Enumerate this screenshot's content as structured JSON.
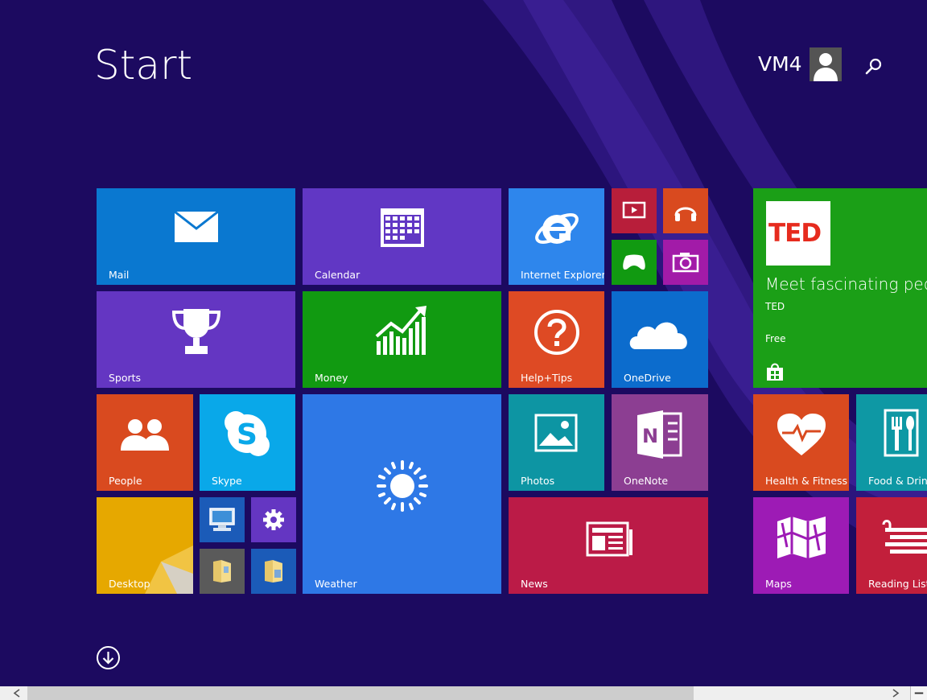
{
  "header": {
    "title": "Start",
    "user_name": "VM4"
  },
  "tiles": {
    "mail": "Mail",
    "calendar": "Calendar",
    "internet_explorer": "Internet Explorer",
    "sports": "Sports",
    "money": "Money",
    "help_tips": "Help+Tips",
    "onedrive": "OneDrive",
    "people": "People",
    "skype": "Skype",
    "weather": "Weather",
    "photos": "Photos",
    "onenote": "OneNote",
    "desktop": "Desktop",
    "news": "News",
    "ted_logo": "TED",
    "ted_headline": "Meet fascinating peo…",
    "ted_name": "TED",
    "ted_price": "Free",
    "health_fitness": "Health & Fitness",
    "food_drink": "Food & Drink",
    "maps": "Maps",
    "reading_list": "Reading List"
  },
  "colors": {
    "background": "#1c0a60",
    "mail": "#0a78d0",
    "calendar": "#6137c4",
    "ie": "#2e86ec",
    "sports": "#6436c2",
    "money": "#119a11",
    "help": "#de4a24",
    "onedrive": "#0c6ccd",
    "people": "#d94a1f",
    "skype": "#09a8e9",
    "weather": "#2e78e6",
    "photos": "#0d95a3",
    "onenote": "#8c3e92",
    "desktop": "#e6a800",
    "news": "#bb1b47",
    "ted": "#1b9f17",
    "health": "#d94a1f",
    "food": "#0e98a4",
    "maps": "#9d1bb5",
    "reading": "#c21f3b"
  }
}
